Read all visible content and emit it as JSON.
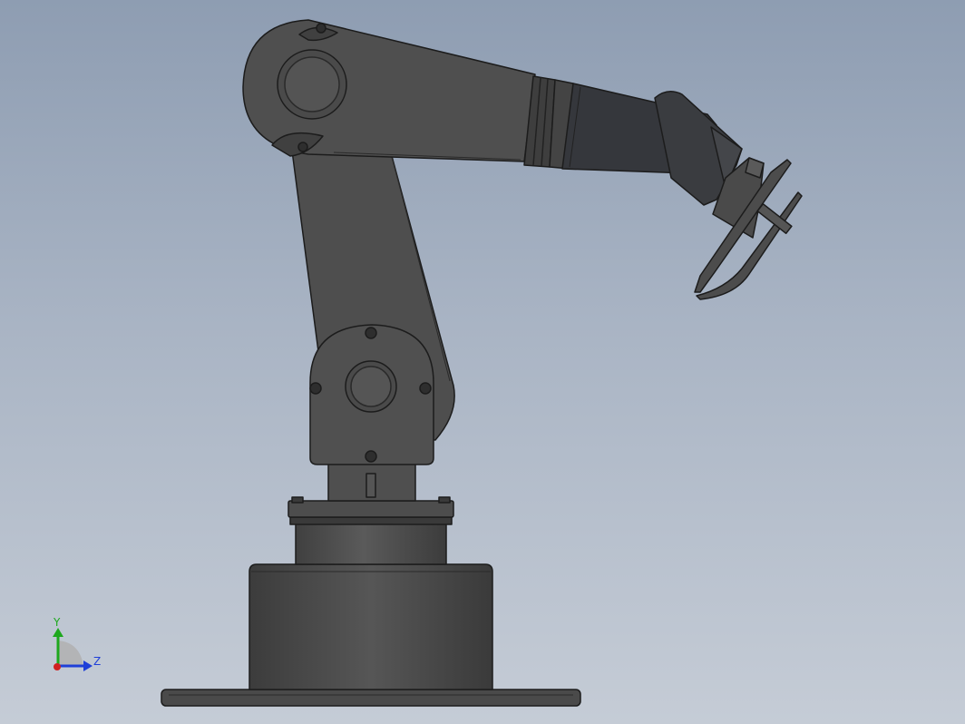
{
  "viewport": {
    "background_top": "#8e9db2",
    "background_bottom": "#c5ccd6"
  },
  "model": {
    "body_color": "#4f4f4f",
    "edge_color": "#1c1c1c",
    "dark_color": "#35373c"
  },
  "triad": {
    "y_label": "Y",
    "z_label": "Z",
    "y_color": "#1ea81e",
    "z_color": "#1f3fd8",
    "x_color": "#d02020"
  }
}
